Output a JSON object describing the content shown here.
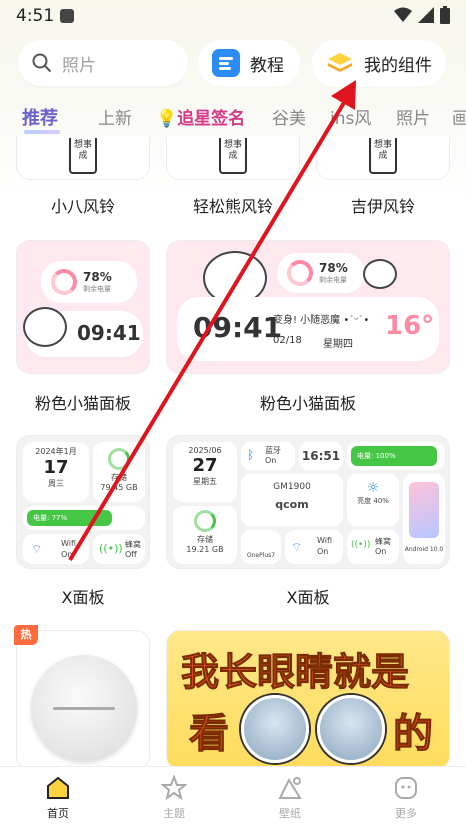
{
  "status_bar": {
    "time": "4:51"
  },
  "search": {
    "placeholder": "照片"
  },
  "top_pills": {
    "tutorial_label": "教程",
    "widgets_label": "我的组件"
  },
  "tabs": [
    "推荐",
    "上新",
    "追星签名",
    "谷美",
    "ins风",
    "照片",
    "画"
  ],
  "row1": {
    "bell_text": "想事成",
    "labels": [
      "小八风铃",
      "轻松熊风铃",
      "吉伊风铃"
    ]
  },
  "row2": {
    "small": {
      "battery_pct": "78%",
      "battery_sub": "剩余电量",
      "time": "09:41"
    },
    "big": {
      "battery_pct": "78%",
      "battery_sub": "剩余电量",
      "time": "09:41",
      "greeting": "变身! 小随恶魔 •˙ᵕ˙•",
      "date": "02/18",
      "weekday": "星期四",
      "temp": "16°"
    },
    "labels": [
      "粉色小猫面板",
      "粉色小猫面板"
    ]
  },
  "row3": {
    "small": {
      "date_line": "2024年1月",
      "day": "17",
      "weekday": "周三",
      "storage_label": "存储",
      "storage_sub": "全部存储",
      "storage_val": "79.45 GB",
      "battery_bar": "电量: 77%",
      "battery_level_pct": 77,
      "wifi_label": "Wifi",
      "wifi_state": "On",
      "cell_label": "蜂窝",
      "cell_state": "Off"
    },
    "big": {
      "date_line": "2025/06",
      "day": "27",
      "weekday": "星期五",
      "bt_label": "蓝牙",
      "bt_state": "On",
      "time": "16:51",
      "battery_bar": "电量: 100%",
      "battery_level_pct": 100,
      "storage_label": "存储",
      "storage_sub": "全部存储",
      "storage_val": "19.21 GB",
      "device": "GM1900",
      "chip": "qcom",
      "brightness": "亮度 40%",
      "wifi_label": "Wifi",
      "wifi_state": "On",
      "cell_label": "蜂窝",
      "cell_state": "On",
      "android": "Android 10.0",
      "oneplus": "OnePlus7"
    },
    "labels": [
      "X面板",
      "X面板"
    ]
  },
  "row4": {
    "hot_badge": "热",
    "banner_line1": "我长眼睛就是",
    "banner_line2_a": "看",
    "banner_line2_b": "的"
  },
  "bottom_nav": [
    "首页",
    "主题",
    "壁纸",
    "更多"
  ],
  "colors": {
    "accent": "#6c63c8",
    "pink_bg": "#fde9ee",
    "green": "#45c745",
    "arrow": "#e0141e"
  }
}
